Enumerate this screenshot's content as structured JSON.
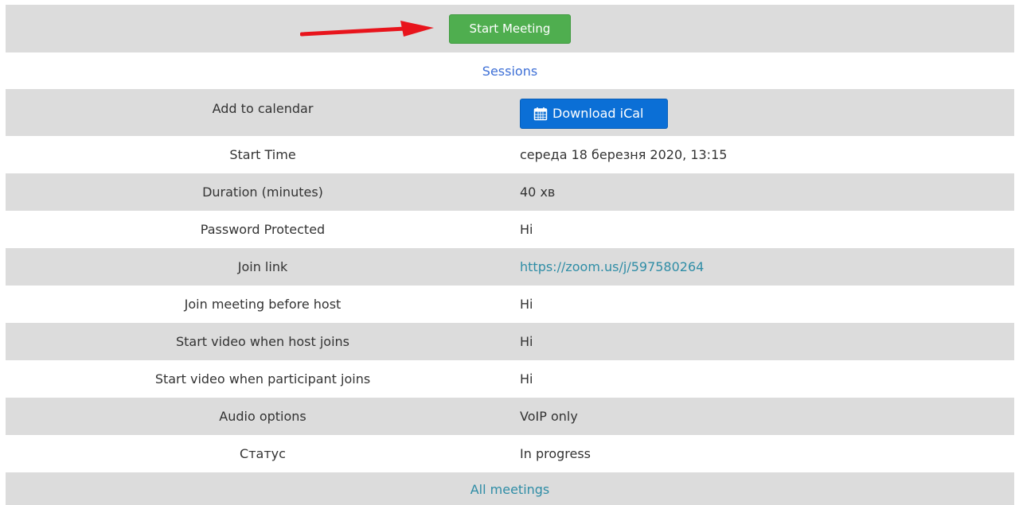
{
  "header": {
    "start_meeting_label": "Start Meeting"
  },
  "sessions_link": "Sessions",
  "calendar": {
    "label": "Add to calendar",
    "button_label": "Download iCal"
  },
  "details": [
    {
      "label": "Start Time",
      "value": "середа 18 березня 2020, 13:15"
    },
    {
      "label": "Duration (minutes)",
      "value": "40 хв"
    },
    {
      "label": "Password Protected",
      "value": "Ні"
    },
    {
      "label": "Join link",
      "value": "https://zoom.us/j/597580264"
    },
    {
      "label": "Join meeting before host",
      "value": "Ні"
    },
    {
      "label": "Start video when host joins",
      "value": "Ні"
    },
    {
      "label": "Start video when participant joins",
      "value": "Ні"
    },
    {
      "label": "Audio options",
      "value": "VoIP only"
    },
    {
      "label": "Статус",
      "value": "In progress"
    }
  ],
  "footer": {
    "all_meetings_link": "All meetings"
  },
  "icons": {
    "calendar": "calendar-icon",
    "annotation": "red-arrow"
  },
  "colors": {
    "start_button": "#4fae4f",
    "ical_button": "#0b6fd6",
    "link_blue": "#3d6fd6",
    "link_teal": "#2f8da6",
    "arrow": "#e8141c",
    "row_alt": "#dcdcdc"
  }
}
